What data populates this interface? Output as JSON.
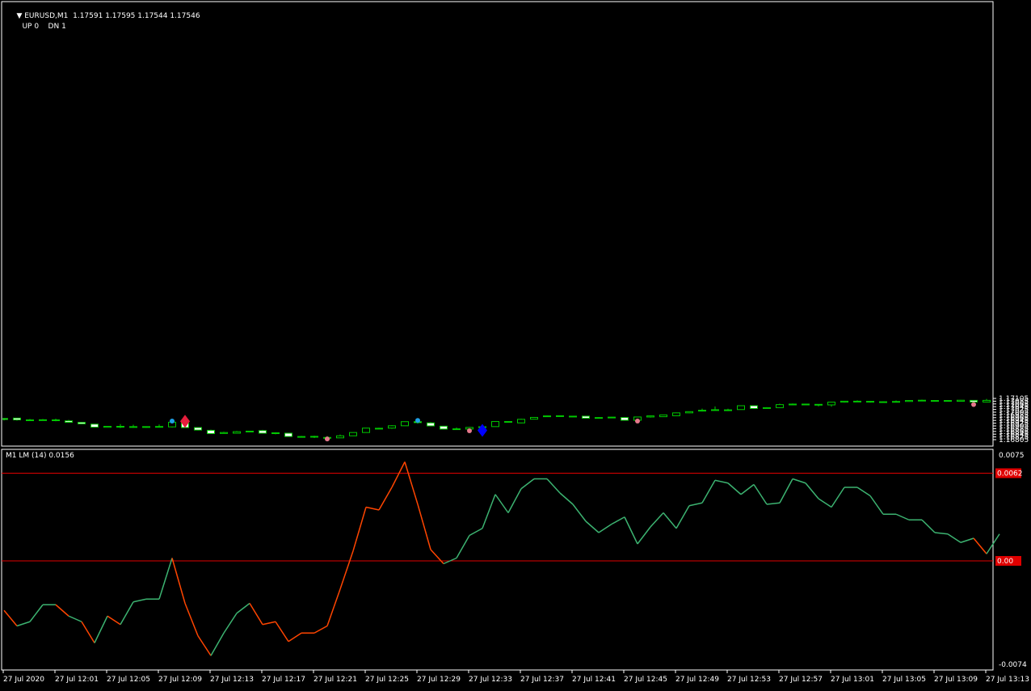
{
  "header": {
    "symbol": "EURUSD,M1",
    "ohlc": "1.17591 1.17595 1.17544 1.17546",
    "up_label": "UP",
    "up_value": "0",
    "dn_label": "DN",
    "dn_value": "1"
  },
  "indicator": {
    "label": "M1 LM (14) 0.0156"
  },
  "colors": {
    "background": "#000000",
    "frame": "#ffffff",
    "candle_up": "#00c800",
    "candle_body_bull": "#000000",
    "candle_body_bear": "#ffffff",
    "indicator_positive": "#3cb371",
    "indicator_negative": "#ff4500",
    "level_line": "#e00000",
    "marker_cyan": "#1ea0e6",
    "marker_pink": "#e6788c",
    "diamond_red": "#e61e3c",
    "diamond_blue": "#0000ff"
  },
  "chart_data": [
    {
      "type": "candlestick",
      "symbol": "EURUSD",
      "timeframe": "M1",
      "ylim": [
        1.168,
        1.17115
      ],
      "y_ticks": [
        "1.17105",
        "1.17085",
        "1.17065",
        "1.17045",
        "1.17025",
        "1.17005",
        "1.16985",
        "1.16965",
        "1.16945",
        "1.16925",
        "1.16905",
        "1.16885",
        "1.16865",
        "1.16845",
        "1.16825",
        "1.16805"
      ],
      "x_ticks": [
        "27 Jul 2020",
        "27 Jul 12:01",
        "27 Jul 12:05",
        "27 Jul 12:09",
        "27 Jul 12:13",
        "27 Jul 12:17",
        "27 Jul 12:21",
        "27 Jul 12:25",
        "27 Jul 12:29",
        "27 Jul 12:33",
        "27 Jul 12:37",
        "27 Jul 12:41",
        "27 Jul 12:45",
        "27 Jul 12:49",
        "27 Jul 12:53",
        "27 Jul 12:57",
        "27 Jul 13:01",
        "27 Jul 13:05",
        "27 Jul 13:09",
        "27 Jul 13:13"
      ],
      "candles": [
        [
          1.16959,
          1.16962,
          1.16945,
          1.16952
        ],
        [
          1.16962,
          1.16964,
          1.16943,
          1.16949
        ],
        [
          1.16949,
          1.16956,
          1.16945,
          1.16947
        ],
        [
          1.16948,
          1.16955,
          1.16945,
          1.1695
        ],
        [
          1.16949,
          1.16958,
          1.16939,
          1.16946
        ],
        [
          1.16942,
          1.16949,
          1.16928,
          1.16931
        ],
        [
          1.16931,
          1.16933,
          1.16917,
          1.1692
        ],
        [
          1.16918,
          1.16919,
          1.16895,
          1.16896
        ],
        [
          1.16895,
          1.16904,
          1.16894,
          1.16902
        ],
        [
          1.16902,
          1.16918,
          1.16889,
          1.16896
        ],
        [
          1.16896,
          1.16914,
          1.16891,
          1.169
        ],
        [
          1.169,
          1.16903,
          1.16892,
          1.16899
        ],
        [
          1.16898,
          1.16915,
          1.16895,
          1.16901
        ],
        [
          1.16898,
          1.16934,
          1.16893,
          1.16932
        ],
        [
          1.16932,
          1.16934,
          1.16893,
          1.16893
        ],
        [
          1.16893,
          1.16895,
          1.16872,
          1.16875
        ],
        [
          1.16873,
          1.16878,
          1.16846,
          1.16849
        ],
        [
          1.1685,
          1.16862,
          1.16849,
          1.16857
        ],
        [
          1.16852,
          1.16868,
          1.16851,
          1.16863
        ],
        [
          1.16863,
          1.16869,
          1.16861,
          1.16867
        ],
        [
          1.16871,
          1.16876,
          1.16852,
          1.16852
        ],
        [
          1.16855,
          1.16859,
          1.16844,
          1.16849
        ],
        [
          1.16852,
          1.16854,
          1.16828,
          1.16828
        ],
        [
          1.16828,
          1.16832,
          1.16823,
          1.16826
        ],
        [
          1.16829,
          1.16834,
          1.16817,
          1.16824
        ],
        [
          1.16821,
          1.16831,
          1.16816,
          1.1682
        ],
        [
          1.16818,
          1.16842,
          1.16817,
          1.16833
        ],
        [
          1.16833,
          1.16858,
          1.16832,
          1.16857
        ],
        [
          1.16857,
          1.16891,
          1.16855,
          1.16889
        ],
        [
          1.16888,
          1.16892,
          1.16885,
          1.16888
        ],
        [
          1.16889,
          1.1691,
          1.16884,
          1.16906
        ],
        [
          1.16906,
          1.16937,
          1.16905,
          1.16936
        ],
        [
          1.16936,
          1.16941,
          1.16921,
          1.16929
        ],
        [
          1.16927,
          1.16933,
          1.16904,
          1.16905
        ],
        [
          1.16903,
          1.16905,
          1.16879,
          1.16882
        ],
        [
          1.16881,
          1.16894,
          1.16876,
          1.16884
        ],
        [
          1.16882,
          1.16898,
          1.16878,
          1.16894
        ],
        [
          1.16894,
          1.16917,
          1.16892,
          1.16899
        ],
        [
          1.169,
          1.16937,
          1.169,
          1.16937
        ],
        [
          1.16937,
          1.16939,
          1.16932,
          1.16933
        ],
        [
          1.16927,
          1.16957,
          1.16924,
          1.16953
        ],
        [
          1.16954,
          1.1697,
          1.16952,
          1.16967
        ],
        [
          1.16972,
          1.16981,
          1.16972,
          1.16978
        ],
        [
          1.16979,
          1.1698,
          1.16972,
          1.16974
        ],
        [
          1.16976,
          1.16978,
          1.16969,
          1.16975
        ],
        [
          1.16976,
          1.16976,
          1.16961,
          1.16961
        ],
        [
          1.16961,
          1.16968,
          1.16961,
          1.16966
        ],
        [
          1.16966,
          1.16971,
          1.16963,
          1.16969
        ],
        [
          1.16966,
          1.16968,
          1.16944,
          1.16946
        ],
        [
          1.16946,
          1.16971,
          1.16946,
          1.1697
        ],
        [
          1.1697,
          1.16981,
          1.16965,
          1.16978
        ],
        [
          1.16972,
          1.16985,
          1.16972,
          1.16985
        ],
        [
          1.16979,
          1.17003,
          1.16978,
          1.17
        ],
        [
          1.17,
          1.17011,
          1.16998,
          1.17009
        ],
        [
          1.17014,
          1.17031,
          1.1701,
          1.17019
        ],
        [
          1.1702,
          1.17047,
          1.17018,
          1.17023
        ],
        [
          1.17022,
          1.1703,
          1.17013,
          1.17022
        ],
        [
          1.17024,
          1.17052,
          1.17024,
          1.17052
        ],
        [
          1.17052,
          1.17053,
          1.17029,
          1.17032
        ],
        [
          1.17032,
          1.17041,
          1.17031,
          1.17038
        ],
        [
          1.17038,
          1.17067,
          1.17037,
          1.1706
        ],
        [
          1.1706,
          1.17068,
          1.17056,
          1.17064
        ],
        [
          1.17064,
          1.17066,
          1.17055,
          1.17058
        ],
        [
          1.17062,
          1.17063,
          1.17047,
          1.17062
        ],
        [
          1.17058,
          1.17078,
          1.17045,
          1.17078
        ],
        [
          1.17078,
          1.17086,
          1.17074,
          1.17085
        ],
        [
          1.17085,
          1.17091,
          1.17079,
          1.17082
        ],
        [
          1.17084,
          1.17087,
          1.17074,
          1.17079
        ],
        [
          1.1708,
          1.17083,
          1.17076,
          1.17081
        ],
        [
          1.17082,
          1.1709,
          1.1708,
          1.17083
        ],
        [
          1.17083,
          1.17093,
          1.17082,
          1.1709
        ],
        [
          1.17092,
          1.17096,
          1.17087,
          1.1709
        ],
        [
          1.1709,
          1.17092,
          1.17087,
          1.17089
        ],
        [
          1.1709,
          1.17091,
          1.17084,
          1.17086
        ],
        [
          1.17084,
          1.17094,
          1.17084,
          1.17092
        ],
        [
          1.17091,
          1.17092,
          1.17067,
          1.17079
        ],
        [
          1.17079,
          1.17101,
          1.17078,
          1.17091
        ]
      ],
      "markers": [
        {
          "type": "dot",
          "color": "cyan",
          "index": 13,
          "price": 1.1694
        },
        {
          "type": "diamond",
          "color": "red",
          "index": 14,
          "price": 1.16939
        },
        {
          "type": "dot",
          "color": "pink",
          "index": 25,
          "price": 1.1681
        },
        {
          "type": "dot",
          "color": "cyan",
          "index": 32,
          "price": 1.16945
        },
        {
          "type": "dot",
          "color": "pink",
          "index": 36,
          "price": 1.1687
        },
        {
          "type": "diamond",
          "color": "blue",
          "index": 37,
          "price": 1.16873
        },
        {
          "type": "dot",
          "color": "pink",
          "index": 49,
          "price": 1.1694
        },
        {
          "type": "dot",
          "color": "pink",
          "index": 75,
          "price": 1.17061
        }
      ]
    },
    {
      "type": "line",
      "title": "M1 LM (14) 0.0156",
      "ylim": [
        -0.0074,
        0.0075
      ],
      "y_ticks": [
        "0.0075",
        "0.00",
        "-0.0074"
      ],
      "levels": [
        {
          "value": 0.0062,
          "label": "0.0062"
        },
        {
          "value": 0.0,
          "label": "0.00"
        }
      ],
      "values": [
        -0.0035,
        -0.0046,
        -0.0043,
        -0.0031,
        -0.0031,
        -0.0039,
        -0.0043,
        -0.0058,
        -0.0039,
        -0.0045,
        -0.0029,
        -0.0027,
        -0.0027,
        0.0002,
        -0.003,
        -0.0053,
        -0.0067,
        -0.0051,
        -0.0037,
        -0.003,
        -0.0045,
        -0.0043,
        -0.0057,
        -0.0051,
        -0.0051,
        -0.0046,
        -0.002,
        0.0007,
        0.0038,
        0.0036,
        0.0052,
        0.007,
        0.004,
        0.0008,
        -0.0002,
        0.0002,
        0.0018,
        0.0023,
        0.0047,
        0.0034,
        0.0051,
        0.0058,
        0.0058,
        0.0048,
        0.004,
        0.0028,
        0.002,
        0.0026,
        0.0031,
        0.0012,
        0.0024,
        0.0034,
        0.0023,
        0.0039,
        0.0041,
        0.0057,
        0.0055,
        0.0047,
        0.0054,
        0.004,
        0.0041,
        0.0058,
        0.0055,
        0.0044,
        0.0038,
        0.0052,
        0.0052,
        0.0046,
        0.0033,
        0.0033,
        0.0029,
        0.0029,
        0.002,
        0.0019,
        0.0013,
        0.0016,
        0.0005,
        0.0019
      ]
    }
  ]
}
